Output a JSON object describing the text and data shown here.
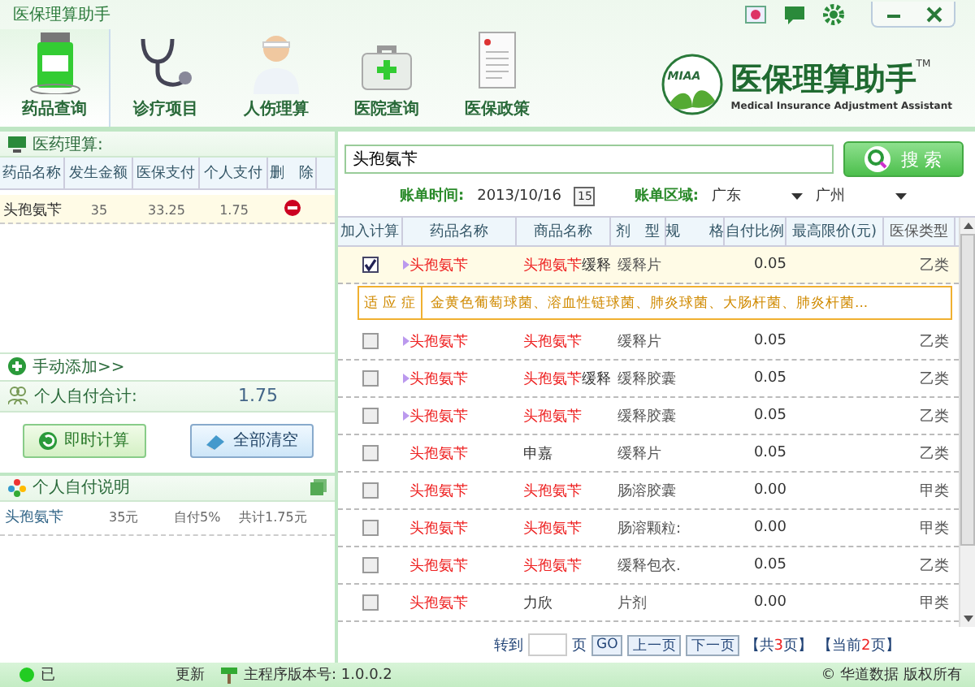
{
  "window": {
    "title": "医保理算助手"
  },
  "nav": [
    {
      "label": "药品查询",
      "selected": true,
      "kind": "bottle"
    },
    {
      "label": "诊疗项目",
      "selected": false,
      "kind": "stethoscope"
    },
    {
      "label": "人伤理算",
      "selected": false,
      "kind": "person"
    },
    {
      "label": "医院查询",
      "selected": false,
      "kind": "kit"
    },
    {
      "label": "医保政策",
      "selected": false,
      "kind": "document"
    }
  ],
  "logo": {
    "badge": "MIAA",
    "name": "医保理算助手",
    "tm": "TM",
    "subtitle": "Medical Insurance Adjustment Assistant"
  },
  "calc": {
    "title": "医药理算:",
    "columns": [
      "药品名称",
      "发生金额",
      "医保支付",
      "个人支付",
      "删　除"
    ],
    "rows": [
      {
        "name": "头孢氨苄",
        "amount": "35",
        "insurance": "33.25",
        "personal": "1.75"
      }
    ],
    "add_link": "手动添加>>",
    "total_label": "个人自付合计:",
    "total": "1.75",
    "buttons": [
      {
        "label": "即时计算",
        "kind": "calc"
      },
      {
        "label": "全部清空",
        "kind": "clear"
      }
    ]
  },
  "notes": {
    "title": "个人自付说明",
    "rows": [
      {
        "name": "头孢氨苄",
        "amount": "35元",
        "ratio": "自付5%",
        "total": "共计1.75元"
      }
    ]
  },
  "search": {
    "value": "头孢氨苄",
    "button": "搜 索"
  },
  "filters": {
    "date_label": "账单时间:",
    "date": "2013/10/16",
    "calendar_day": "15",
    "region_label": "账单区域:",
    "province": "广东",
    "city": "广州"
  },
  "table": {
    "columns": [
      "加入计算",
      "药品名称",
      "商品名称",
      "剂　型",
      "规　　格",
      "自付比例",
      "最高限价(元)",
      "医保类型"
    ],
    "rows": [
      {
        "checked": true,
        "selected": true,
        "has_detail": true,
        "name": "头孢氨苄",
        "trade_match": "头孢氨苄",
        "trade_rest": "缓释",
        "form": "缓释片",
        "ratio": "0.05",
        "type": "乙类",
        "indication_label": "适 应 症",
        "indication": "金黄色葡萄球菌、溶血性链球菌、肺炎球菌、大肠杆菌、肺炎杆菌..."
      },
      {
        "checked": false,
        "selected": false,
        "has_detail": true,
        "name": "头孢氨苄",
        "trade_match": "头孢氨苄",
        "form": "缓释片",
        "ratio": "0.05",
        "type": "乙类"
      },
      {
        "checked": false,
        "selected": false,
        "has_detail": true,
        "name": "头孢氨苄",
        "trade_match": "头孢氨苄",
        "trade_rest": "缓释",
        "form": "缓释胶囊",
        "ratio": "0.05",
        "type": "乙类"
      },
      {
        "checked": false,
        "selected": false,
        "has_detail": true,
        "name": "头孢氨苄",
        "trade_match": "头孢氨苄",
        "form": "缓释胶囊",
        "ratio": "0.05",
        "type": "乙类"
      },
      {
        "checked": false,
        "selected": false,
        "has_detail": false,
        "name": "头孢氨苄",
        "trade_rest": "申嘉",
        "form": "缓释片",
        "ratio": "0.05",
        "type": "乙类"
      },
      {
        "checked": false,
        "selected": false,
        "has_detail": false,
        "name": "头孢氨苄",
        "trade_match": "头孢氨苄",
        "form": "肠溶胶囊",
        "ratio": "0.00",
        "type": "甲类"
      },
      {
        "checked": false,
        "selected": false,
        "has_detail": false,
        "name": "头孢氨苄",
        "trade_match": "头孢氨苄",
        "form": "肠溶颗粒:",
        "ratio": "0.00",
        "type": "甲类"
      },
      {
        "checked": false,
        "selected": false,
        "has_detail": false,
        "name": "头孢氨苄",
        "trade_match": "头孢氨苄",
        "form": "缓释包衣.",
        "ratio": "0.05",
        "type": "乙类"
      },
      {
        "checked": false,
        "selected": false,
        "has_detail": false,
        "name": "头孢氨苄",
        "trade_rest": "力欣",
        "form": "片剂",
        "ratio": "0.00",
        "type": "甲类"
      }
    ]
  },
  "pager": {
    "goto": "转到",
    "page": "页",
    "go": "GO",
    "prev": "上一页",
    "next": "下一页",
    "info": [
      {
        "open": "【共",
        "number": "3",
        "close": "页】"
      },
      {
        "open": "【当前",
        "number": "2",
        "close": "页】"
      }
    ]
  },
  "status_bar": {
    "left": "已",
    "update": "更新",
    "version": "主程序版本号: 1.0.0.2",
    "copyright": "© 华道数据 版权所有"
  }
}
